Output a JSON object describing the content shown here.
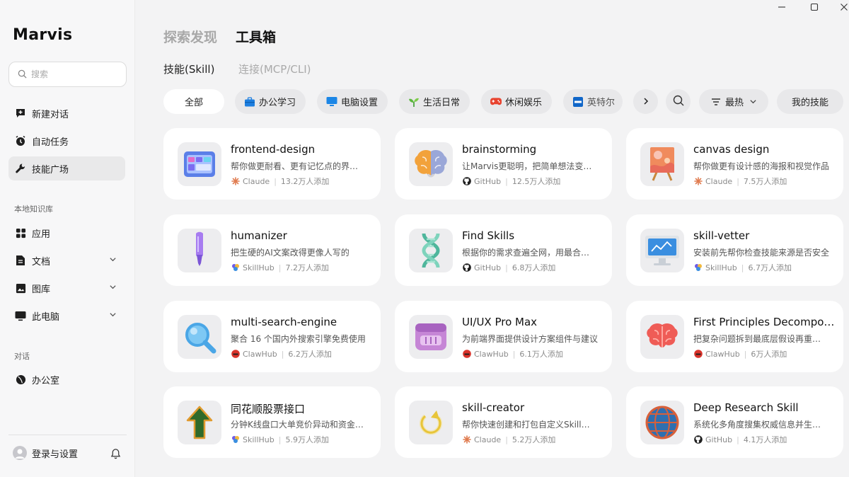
{
  "app": {
    "brand": "Marvis"
  },
  "sidebar": {
    "search_placeholder": "搜索",
    "primary": [
      {
        "label": "新建对话",
        "icon": "new-chat-icon"
      },
      {
        "label": "自动任务",
        "icon": "clock-icon"
      },
      {
        "label": "技能广场",
        "icon": "wrench-icon"
      }
    ],
    "kb_label": "本地知识库",
    "kb_items": [
      {
        "label": "应用",
        "icon": "apps-icon"
      },
      {
        "label": "文档",
        "icon": "document-icon"
      },
      {
        "label": "图库",
        "icon": "gallery-icon"
      },
      {
        "label": "此电脑",
        "icon": "computer-icon"
      }
    ],
    "chat_label": "对话",
    "chat_items": [
      {
        "label": "办公室",
        "icon": "office-icon"
      }
    ],
    "login_label": "登录与设置"
  },
  "main": {
    "top_tabs": [
      "探索发现",
      "工具箱"
    ],
    "sub_tabs": [
      "技能(Skill)",
      "连接(MCP/CLI)"
    ],
    "chips": [
      {
        "label": "全部"
      },
      {
        "label": "办公学习",
        "icon": "briefcase-icon"
      },
      {
        "label": "电脑设置",
        "icon": "monitor-icon"
      },
      {
        "label": "生活日常",
        "icon": "sprout-icon"
      },
      {
        "label": "休闲娱乐",
        "icon": "gamepad-icon"
      },
      {
        "label": "英特尔",
        "icon": "intel-icon"
      }
    ],
    "sort_label": "最热",
    "my_skills_label": "我的技能"
  },
  "cards": [
    {
      "title": "frontend-design",
      "desc": "帮你做更耐看、更有记忆点的界面设计",
      "source": "Claude",
      "count": "13.2万人添加",
      "thumb": "frontend"
    },
    {
      "title": "brainstorming",
      "desc": "让Marvis更聪明，把简单想法变成完整方案",
      "source": "GitHub",
      "count": "12.5万人添加",
      "thumb": "brain-color"
    },
    {
      "title": "canvas design",
      "desc": "帮你做更有设计感的海报和视觉作品",
      "source": "Claude",
      "count": "7.5万人添加",
      "thumb": "easel"
    },
    {
      "title": "humanizer",
      "desc": "把生硬的AI文案改得更像人写的",
      "source": "SkillHub",
      "count": "7.2万人添加",
      "thumb": "pen"
    },
    {
      "title": "Find Skills",
      "desc": "根据你的需求查遍全网，用最合适的技能",
      "source": "GitHub",
      "count": "6.8万人添加",
      "thumb": "dna"
    },
    {
      "title": "skill-vetter",
      "desc": "安装前先帮你检查技能来源是否安全",
      "source": "SkillHub",
      "count": "6.7万人添加",
      "thumb": "screen"
    },
    {
      "title": "multi-search-engine",
      "desc": "聚合 16 个国内外搜索引擎免费使用",
      "source": "ClawHub",
      "count": "6.2万人添加",
      "thumb": "magnifier"
    },
    {
      "title": "UI/UX Pro Max",
      "desc": "为前端界面提供设计方案组件与建议",
      "source": "ClawHub",
      "count": "6.1万人添加",
      "thumb": "calendar"
    },
    {
      "title": "First Principles Decomposer",
      "desc": "把复杂问题拆到最底层假设再重新推导",
      "source": "ClawHub",
      "count": "6万人添加",
      "thumb": "brain-red"
    },
    {
      "title": "同花顺股票接口",
      "desc": "分钟K线盘口大单竞价异动和资金流向",
      "source": "SkillHub",
      "count": "5.9万人添加",
      "thumb": "arrow"
    },
    {
      "title": "skill-creator",
      "desc": "帮你快速创建和打包自定义Skill技能",
      "source": "Claude",
      "count": "5.2万人添加",
      "thumb": "refresh"
    },
    {
      "title": "Deep Research Skill",
      "desc": "系统化多角度搜集权威信息并生成报告",
      "source": "GitHub",
      "count": "4.1万人添加",
      "thumb": "globe"
    }
  ]
}
